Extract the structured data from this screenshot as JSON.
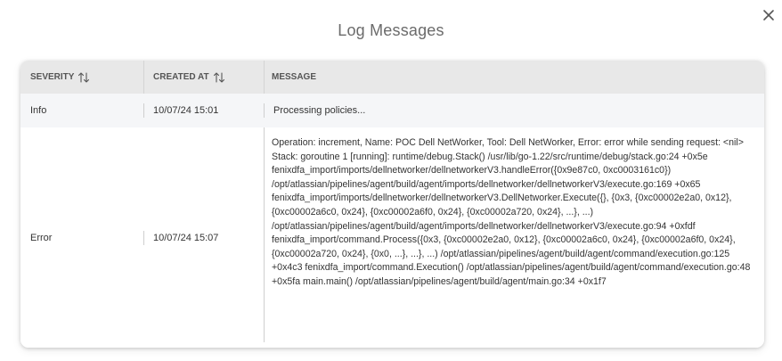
{
  "dialog": {
    "title": "Log Messages",
    "close_icon": "close-icon"
  },
  "table": {
    "columns": [
      {
        "label": "SEVERITY",
        "sortable": true
      },
      {
        "label": "CREATED AT",
        "sortable": true
      },
      {
        "label": "MESSAGE",
        "sortable": false
      }
    ],
    "rows": [
      {
        "severity": "Info",
        "created_at": "10/07/24 15:01",
        "message": "Processing policies..."
      },
      {
        "severity": "Error",
        "created_at": "10/07/24 15:07",
        "message": "Operation: increment, Name: POC Dell NetWorker, Tool: Dell NetWorker, Error: error while sending request: <nil> Stack: goroutine 1 [running]: runtime/debug.Stack() /usr/lib/go-1.22/src/runtime/debug/stack.go:24 +0x5e fenixdfa_import/imports/dellnetworker/dellnetworkerV3.handleError({0x9e87c0, 0xc0003161c0}) /opt/atlassian/pipelines/agent/build/agent/imports/dellnetworker/dellnetworkerV3/execute.go:169 +0x65 fenixdfa_import/imports/dellnetworker/dellnetworkerV3.DellNetworker.Execute({}, {0x3, {0xc00002e2a0, 0x12}, {0xc00002a6c0, 0x24}, {0xc00002a6f0, 0x24}, {0xc00002a720, 0x24}, ...}, ...) /opt/atlassian/pipelines/agent/build/agent/imports/dellnetworker/dellnetworkerV3/execute.go:94 +0xfdf fenixdfa_import/command.Process({0x3, {0xc00002e2a0, 0x12}, {0xc00002a6c0, 0x24}, {0xc00002a6f0, 0x24}, {0xc00002a720, 0x24}, {0x0, ...}, ...}, ...) /opt/atlassian/pipelines/agent/build/agent/command/execution.go:125 +0x4c3 fenixdfa_import/command.Execution() /opt/atlassian/pipelines/agent/build/agent/command/execution.go:48 +0x5fa main.main() /opt/atlassian/pipelines/agent/build/agent/main.go:34 +0x1f7"
      }
    ]
  },
  "colors": {
    "header_bg": "#e8e8e8",
    "info_row_bg": "#f5f6f8",
    "title_color": "#6b6b6b"
  }
}
